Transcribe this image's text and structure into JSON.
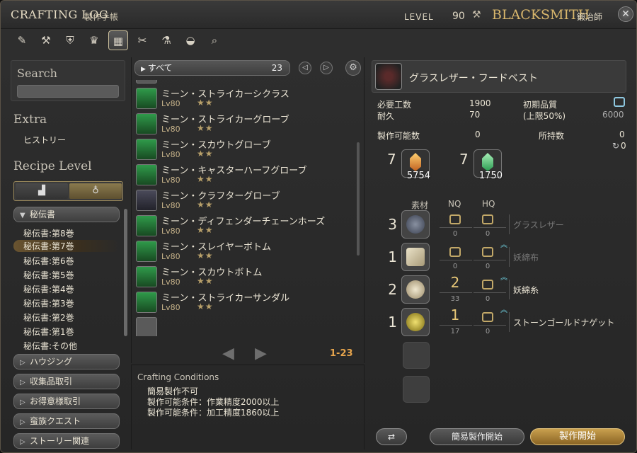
{
  "window": {
    "title": "CRAFTING LOG",
    "title_jp": "製作手帳",
    "level_label": "LEVEL",
    "level": "90",
    "job": "BLACKSMITH",
    "job_jp": "鍛冶師"
  },
  "toolbar": {
    "icons": [
      "carpenter-icon",
      "blacksmith-icon",
      "armorer-icon",
      "goldsmith-icon",
      "leatherworker-icon",
      "weaver-icon",
      "alchemist-icon",
      "culinarian-icon",
      "search-icon"
    ],
    "active_index": 4
  },
  "sidebar": {
    "search_title": "Search",
    "search_value": "",
    "extra_title": "Extra",
    "history": "ヒストリー",
    "recipe_level_title": "Recipe Level",
    "open_category": "秘伝書",
    "sub_items": [
      "秘伝書:第8巻",
      "秘伝書:第7巻",
      "秘伝書:第6巻",
      "秘伝書:第5巻",
      "秘伝書:第4巻",
      "秘伝書:第3巻",
      "秘伝書:第2巻",
      "秘伝書:第1巻",
      "秘伝書:その他"
    ],
    "selected_sub": 1,
    "categories": [
      "ハウジング",
      "収集品取引",
      "お得意様取引",
      "蛮族クエスト",
      "ストーリー関連"
    ]
  },
  "recipes": {
    "filter": "すべて",
    "count": "23",
    "items": [
      {
        "name": "ミーン・ストライカーシクラス",
        "lv": "Lv80",
        "stars": "★★"
      },
      {
        "name": "ミーン・ストライカーグローブ",
        "lv": "Lv80",
        "stars": "★★"
      },
      {
        "name": "ミーン・スカウトグローブ",
        "lv": "Lv80",
        "stars": "★★"
      },
      {
        "name": "ミーン・キャスターハーフグローブ",
        "lv": "Lv80",
        "stars": "★★"
      },
      {
        "name": "ミーン・クラフターグローブ",
        "lv": "Lv80",
        "stars": "★★"
      },
      {
        "name": "ミーン・ディフェンダーチェーンホーズ",
        "lv": "Lv80",
        "stars": "★★"
      },
      {
        "name": "ミーン・スレイヤーボトム",
        "lv": "Lv80",
        "stars": "★★"
      },
      {
        "name": "ミーン・スカウトボトム",
        "lv": "Lv80",
        "stars": "★★"
      },
      {
        "name": "ミーン・ストライカーサンダル",
        "lv": "Lv80",
        "stars": "★★"
      }
    ],
    "range": "1-23"
  },
  "conditions": {
    "title": "Crafting Conditions",
    "lines": [
      "簡易製作不可",
      "製作可能条件：作業精度2000以上",
      "製作可能条件：加工精度1860以上"
    ]
  },
  "detail": {
    "item_name": "グラスレザー・フードベスト",
    "req_work_label": "必要工数",
    "req_work": "1900",
    "durability_label": "耐久",
    "durability": "70",
    "init_quality_label": "初期品質",
    "init_quality_cap": "(上限50%)",
    "init_quality_max": "6000",
    "craftable_label": "製作可能数",
    "craftable": "0",
    "owned_label": "所持数",
    "owned": "0",
    "owned_hq": "0",
    "crystals": [
      {
        "need": "7",
        "qty": "5754",
        "color": "#e8a040"
      },
      {
        "need": "7",
        "qty": "1750",
        "color": "#5ad07a"
      }
    ],
    "mat_headers": {
      "material": "素材",
      "nq": "NQ",
      "hq": "HQ"
    },
    "materials": [
      {
        "need": "3",
        "nq": "",
        "hq": "",
        "nq_owned": "0",
        "hq_owned": "0",
        "name": "グラスレザー",
        "dim": true,
        "hq_arrow": false,
        "color": "#6a7080"
      },
      {
        "need": "1",
        "nq": "",
        "hq": "",
        "nq_owned": "0",
        "hq_owned": "0",
        "name": "妖綿布",
        "dim": true,
        "hq_arrow": true,
        "color": "#d8d0b8"
      },
      {
        "need": "2",
        "nq": "2",
        "hq": "",
        "nq_owned": "33",
        "hq_owned": "0",
        "name": "妖綿糸",
        "dim": false,
        "hq_arrow": true,
        "color": "#d8d0b0"
      },
      {
        "need": "1",
        "nq": "1",
        "hq": "",
        "nq_owned": "17",
        "hq_owned": "0",
        "name": "ストーンゴールドナゲット",
        "dim": false,
        "hq_arrow": true,
        "color": "#c8b040"
      }
    ],
    "quick_synth_label": "簡易製作開始",
    "synth_label": "製作開始"
  }
}
